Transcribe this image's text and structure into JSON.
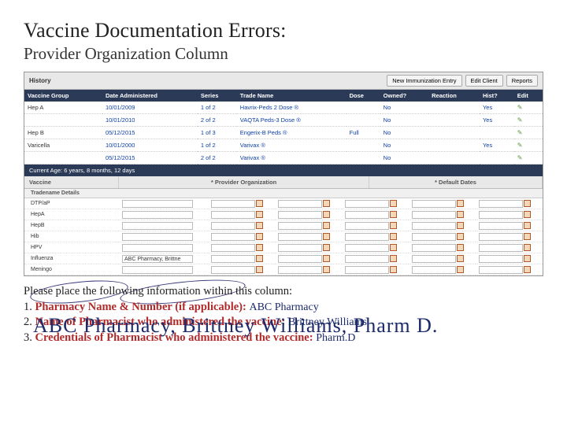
{
  "title": "Vaccine Documentation Errors:",
  "subtitle": "Provider Organization Column",
  "toolbar": {
    "history_label": "History",
    "buttons": [
      "New Immunization Entry",
      "Edit Client",
      "Reports"
    ]
  },
  "history_table": {
    "headers": [
      "Vaccine Group",
      "Date Administered",
      "Series",
      "Trade Name",
      "Dose",
      "Owned?",
      "Reaction",
      "Hist?",
      "Edit"
    ],
    "rows": [
      {
        "group": "Hep A",
        "date": "10/01/2009",
        "series": "1 of 2",
        "trade": "Havrix-Peds 2 Dose ®",
        "dose": "",
        "owned": "No",
        "reaction": "",
        "hist": "Yes"
      },
      {
        "group": "",
        "date": "10/01/2010",
        "series": "2 of 2",
        "trade": "VAQTA Peds-3 Dose ®",
        "dose": "",
        "owned": "No",
        "reaction": "",
        "hist": "Yes"
      },
      {
        "group": "Hep B",
        "date": "05/12/2015",
        "series": "1 of 3",
        "trade": "Engerix-B Peds ®",
        "dose": "Full",
        "owned": "No",
        "reaction": "",
        "hist": ""
      },
      {
        "group": "Varicella",
        "date": "10/01/2000",
        "series": "1 of 2",
        "trade": "Varivax ®",
        "dose": "",
        "owned": "No",
        "reaction": "",
        "hist": "Yes"
      },
      {
        "group": "",
        "date": "05/12/2015",
        "series": "2 of 2",
        "trade": "Varivax ®",
        "dose": "",
        "owned": "No",
        "reaction": "",
        "hist": ""
      }
    ]
  },
  "age_bar": "Current Age: 6 years, 8 months, 12 days",
  "section_headers": {
    "vaccine": "Vaccine",
    "provider_org": "* Provider Organization",
    "default_dates": "* Default Dates"
  },
  "entry_header": {
    "left": "Tradename Details"
  },
  "vaccines": [
    "DTP/aP",
    "HepA",
    "HepB",
    "Hib",
    "HPV",
    "Influenza",
    "Meningo"
  ],
  "filled_provider": "ABC Pharmacy, Brittne",
  "instructions": {
    "line0": "Please place the following information within this column:",
    "item1_label": "Pharmacy Name & Number (if applicable):",
    "item1_value": "ABC Pharmacy",
    "item2_prefix": "2.",
    "item2_mixed": "Name of Pharmacist who administered the vaccine:",
    "item2_value": "Brittney Williams",
    "item3_label": "Credentials of Pharmacist who administered the vaccine:",
    "item3_value": "Pharm.D",
    "overlay": "ABC Pharmacy, Brittney Williams, Pharm D."
  }
}
